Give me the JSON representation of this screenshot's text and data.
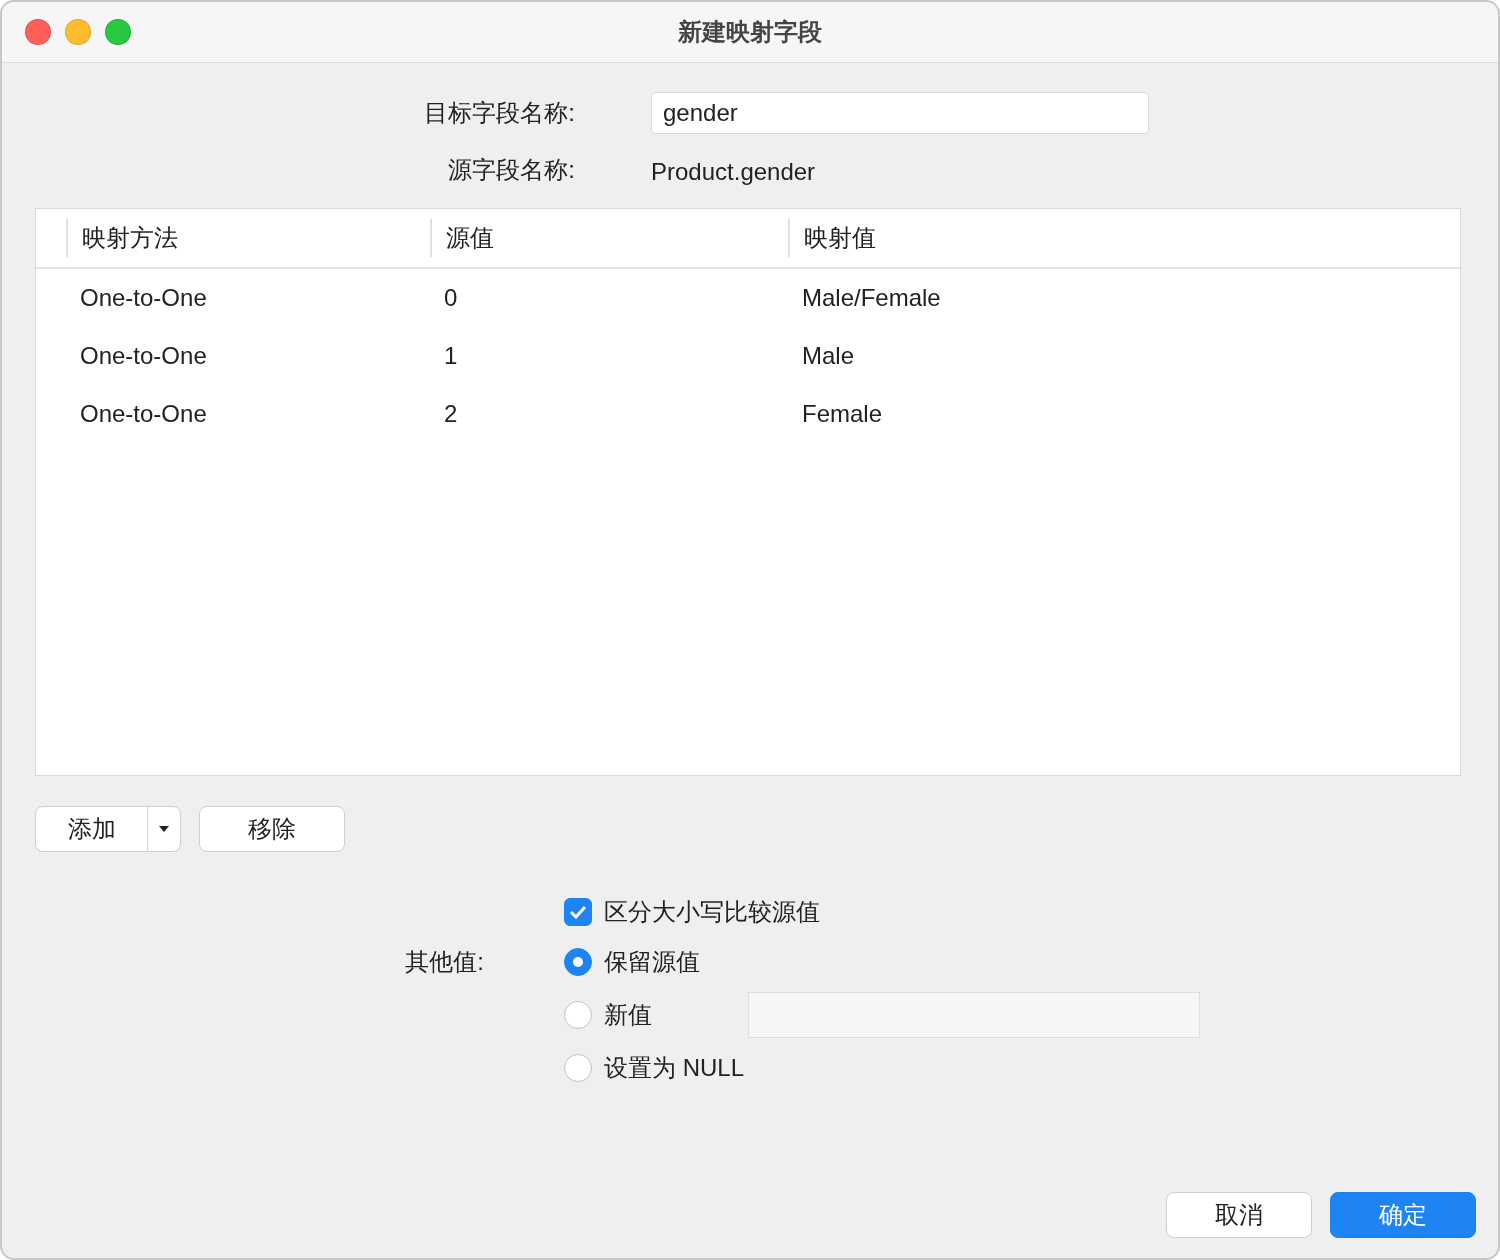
{
  "window": {
    "title": "新建映射字段"
  },
  "form": {
    "target_label": "目标字段名称:",
    "target_value": "gender",
    "source_label": "源字段名称:",
    "source_value": "Product.gender"
  },
  "table": {
    "columns": [
      "映射方法",
      "源值",
      "映射值"
    ],
    "rows": [
      [
        "One-to-One",
        "0",
        "Male/Female"
      ],
      [
        "One-to-One",
        "1",
        "Male"
      ],
      [
        "One-to-One",
        "2",
        "Female"
      ]
    ]
  },
  "table_buttons": {
    "add": "添加",
    "remove": "移除"
  },
  "case_sensitive": {
    "label": "区分大小写比较源值",
    "checked": true
  },
  "other_values": {
    "label": "其他值:",
    "options": [
      {
        "label": "保留源值",
        "selected": true,
        "kind": "plain"
      },
      {
        "label": "新值",
        "selected": false,
        "kind": "with-field"
      },
      {
        "label": "设置为 NULL",
        "selected": false,
        "kind": "plain"
      }
    ]
  },
  "footer": {
    "cancel": "取消",
    "ok": "确定"
  }
}
